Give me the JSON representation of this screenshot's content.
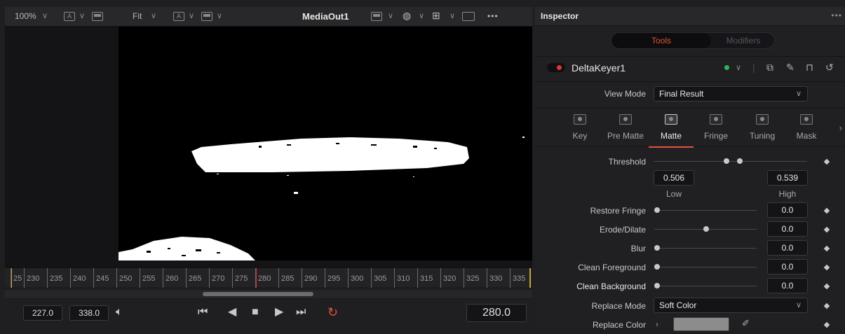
{
  "viewer": {
    "zoom": "100%",
    "fit": "Fit",
    "title": "MediaOut1",
    "more": "•••",
    "ruler_ticks": [
      "25",
      "230",
      "235",
      "240",
      "245",
      "250",
      "255",
      "260",
      "265",
      "270",
      "275",
      "280",
      "285",
      "290",
      "295",
      "300",
      "305",
      "310",
      "315",
      "320",
      "325",
      "330",
      "335"
    ],
    "current_marker": "280",
    "render_start": "227.0",
    "render_end": "338.0",
    "current_time": "280.0"
  },
  "inspector": {
    "title": "Inspector",
    "more": "•••",
    "tabs_top": {
      "tools": "Tools",
      "modifiers": "Modifiers"
    },
    "node_name": "DeltaKeyer1",
    "view_mode": {
      "label": "View Mode",
      "value": "Final Result"
    },
    "tabs": [
      {
        "label": "Key",
        "icon": "key-tab-icon"
      },
      {
        "label": "Pre Matte",
        "icon": "pre-matte-tab-icon"
      },
      {
        "label": "Matte",
        "icon": "matte-tab-icon",
        "active": true
      },
      {
        "label": "Fringe",
        "icon": "fringe-tab-icon"
      },
      {
        "label": "Tuning",
        "icon": "tuning-tab-icon"
      },
      {
        "label": "Mask",
        "icon": "mask-tab-icon"
      }
    ],
    "threshold": {
      "label": "Threshold",
      "low": "0.506",
      "high": "0.539",
      "low_label": "Low",
      "high_label": "High"
    },
    "params": [
      {
        "label": "Restore Fringe",
        "value": "0.0",
        "level": 0.0
      },
      {
        "label": "Erode/Dilate",
        "value": "0.0",
        "level": 0.5
      },
      {
        "label": "Blur",
        "value": "0.0",
        "level": 0.0
      },
      {
        "label": "Clean Foreground",
        "value": "0.0",
        "level": 0.0
      },
      {
        "label": "Clean Background",
        "value": "0.0",
        "level": 0.0
      }
    ],
    "replace_mode": {
      "label": "Replace Mode",
      "value": "Soft Color"
    },
    "replace_color": {
      "label": "Replace Color",
      "swatch": "#8c8c8c"
    }
  },
  "colors": {
    "accent": "#e0533a",
    "status_green": "#2fb55a",
    "node_red": "#e0333a"
  }
}
